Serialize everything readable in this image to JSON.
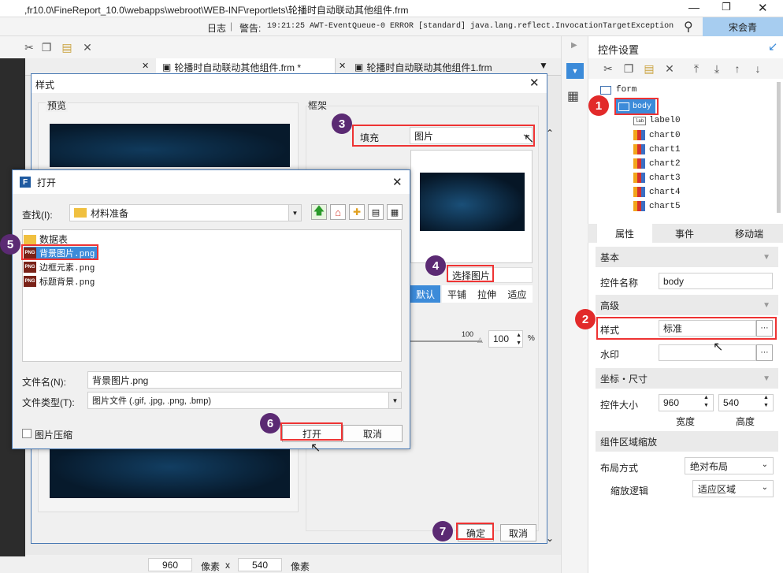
{
  "titlebar": {
    "path": ",fr10.0\\FineReport_10.0\\webapps\\webroot\\WEB-INF\\reportlets\\轮播时自动联动其他组件.frm"
  },
  "statusbar": {
    "log_label": "日志",
    "warning_prefix": "警告:",
    "warning_text": "19:21:25 AWT-EventQueue-0 ERROR [standard] java.lang.reflect.InvocationTargetException",
    "user": "宋会青"
  },
  "tabs": [
    {
      "label": "轮播时自动联动其他组件.frm *"
    },
    {
      "label": "轮播时自动联动其他组件1.frm"
    }
  ],
  "style_dialog": {
    "title": "样式",
    "preview_label": "预览",
    "frame_label": "框架",
    "fill_label": "填充",
    "fill_value": "图片",
    "choose_image_label": "选择图片",
    "modes": [
      "默认",
      "平铺",
      "拉伸",
      "适应"
    ],
    "opacity_tick": "100",
    "opacity_value": "100",
    "opacity_unit": "%",
    "ok_label": "确定",
    "cancel_label": "取消"
  },
  "open_dialog": {
    "title": "打开",
    "lookin_label": "查找(I):",
    "lookin_value": "材料准备",
    "files": [
      {
        "name": "数据表",
        "type": "folder"
      },
      {
        "name": "背景图片.png",
        "type": "png"
      },
      {
        "name": "边框元素.png",
        "type": "png"
      },
      {
        "name": "标题背景.png",
        "type": "png"
      }
    ],
    "filename_label": "文件名(N):",
    "filename_value": "背景图片.png",
    "filetype_label": "文件类型(T):",
    "filetype_value": "图片文件 (.gif, .jpg, .png, .bmp)",
    "compress_label": "图片压缩",
    "open_label": "打开",
    "cancel_label": "取消"
  },
  "right_panel": {
    "title": "控件设置",
    "tree": {
      "root": "form",
      "selected": "body",
      "children": [
        "label0",
        "chart0",
        "chart1",
        "chart2",
        "chart3",
        "chart4",
        "chart5"
      ]
    },
    "tabs": [
      "属性",
      "事件",
      "移动端"
    ],
    "sections": {
      "basic": "基本",
      "advanced": "高级",
      "coords": "坐标・尺寸",
      "zoom": "组件区域缩放"
    },
    "name_label": "控件名称",
    "name_value": "body",
    "style_label": "样式",
    "style_value": "标准",
    "watermark_label": "水印",
    "size_label": "控件大小",
    "width_value": "960",
    "height_value": "540",
    "width_caption": "宽度",
    "height_caption": "高度",
    "layout_label": "布局方式",
    "layout_value": "绝对布局",
    "scale_label": "缩放逻辑",
    "scale_value": "适应区域"
  },
  "bottom_bar": {
    "width": "960",
    "height": "540",
    "unit": "像素",
    "times": "x"
  },
  "badges": [
    "1",
    "2",
    "3",
    "4",
    "5",
    "6",
    "7"
  ],
  "colors": {
    "accent": "#3c8bd9",
    "badge_red": "#e22a2a",
    "badge_dark": "#5b2a73",
    "highlight": "#e33333"
  }
}
